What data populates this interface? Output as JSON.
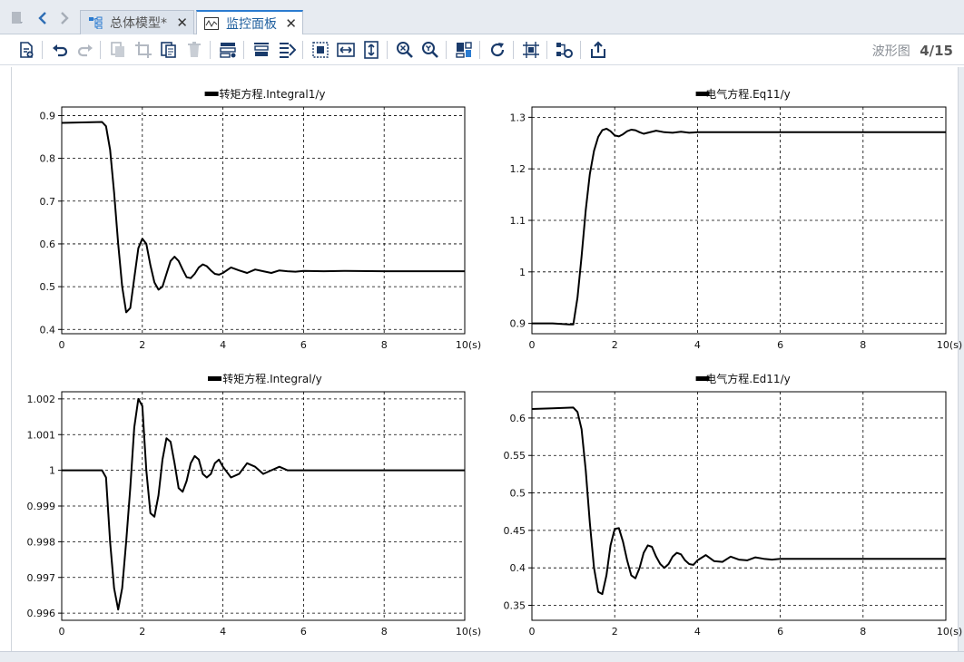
{
  "tabbar": {
    "tabs": [
      {
        "label": "总体模型*",
        "active": false
      },
      {
        "label": "监控面板",
        "active": true
      }
    ]
  },
  "toolbar": {
    "view_label": "波形图",
    "page_indicator": "4/15",
    "icons": [
      "new-page-icon",
      "undo-icon",
      "redo-icon",
      "copy-icon",
      "crop-icon",
      "paste-icon",
      "delete-icon",
      "layout-icon",
      "align-icon",
      "align-right-icon",
      "fit-selection-icon",
      "fit-width-icon",
      "fit-height-icon",
      "zoom-in-icon",
      "zoom-out-icon",
      "panel-icon",
      "refresh-icon",
      "grid-select-icon",
      "connect-icon",
      "export-icon"
    ]
  },
  "colors": {
    "accent": "#2b7bd0",
    "curve": "#000000",
    "grid": "#000000"
  },
  "chart_data": [
    {
      "type": "line",
      "title": "转矩方程.Integral1/y",
      "x_unit_label": "10(s)",
      "xlim": [
        0,
        10
      ],
      "ylim": [
        0.39,
        0.92
      ],
      "xticks": [
        0,
        2,
        4,
        6,
        8,
        10
      ],
      "yticks": [
        0.4,
        0.5,
        0.6,
        0.7,
        0.8,
        0.9
      ],
      "ytick_labels": [
        "0.4",
        "0.5",
        "0.6",
        "0.7",
        "0.8",
        "0.9"
      ],
      "grid": true,
      "legend": "top-center",
      "series": [
        {
          "name": "转矩方程.Integral1/y",
          "x": [
            0,
            0.5,
            1.0,
            1.1,
            1.2,
            1.3,
            1.4,
            1.5,
            1.6,
            1.7,
            1.8,
            1.9,
            2.0,
            2.1,
            2.2,
            2.3,
            2.4,
            2.5,
            2.6,
            2.7,
            2.8,
            2.9,
            3.0,
            3.1,
            3.2,
            3.3,
            3.4,
            3.5,
            3.6,
            3.7,
            3.8,
            3.9,
            4.0,
            4.2,
            4.4,
            4.6,
            4.8,
            5.0,
            5.2,
            5.4,
            5.6,
            5.8,
            6.0,
            6.5,
            7.0,
            8.0,
            9.0,
            10.0
          ],
          "y": [
            0.883,
            0.884,
            0.885,
            0.875,
            0.82,
            0.72,
            0.6,
            0.5,
            0.44,
            0.45,
            0.52,
            0.59,
            0.612,
            0.6,
            0.55,
            0.51,
            0.493,
            0.5,
            0.53,
            0.56,
            0.57,
            0.56,
            0.54,
            0.522,
            0.52,
            0.53,
            0.545,
            0.552,
            0.548,
            0.538,
            0.53,
            0.528,
            0.532,
            0.545,
            0.538,
            0.532,
            0.54,
            0.536,
            0.532,
            0.538,
            0.536,
            0.535,
            0.537,
            0.536,
            0.537,
            0.536,
            0.536,
            0.536
          ]
        }
      ]
    },
    {
      "type": "line",
      "title": "电气方程.Eq11/y",
      "x_unit_label": "10(s)",
      "xlim": [
        0,
        10
      ],
      "ylim": [
        0.88,
        1.32
      ],
      "xticks": [
        0,
        2,
        4,
        6,
        8,
        10
      ],
      "yticks": [
        0.9,
        1.0,
        1.1,
        1.2,
        1.3
      ],
      "ytick_labels": [
        "0.9",
        "1",
        "1.1",
        "1.2",
        "1.3"
      ],
      "grid": true,
      "legend": "top-center",
      "series": [
        {
          "name": "电气方程.Eq11/y",
          "x": [
            0,
            0.5,
            0.9,
            1.0,
            1.1,
            1.2,
            1.3,
            1.4,
            1.5,
            1.6,
            1.7,
            1.8,
            1.9,
            2.0,
            2.1,
            2.2,
            2.3,
            2.4,
            2.5,
            2.6,
            2.7,
            2.8,
            3.0,
            3.2,
            3.4,
            3.6,
            3.8,
            4.0,
            4.5,
            5.0,
            6.0,
            7.0,
            8.0,
            9.0,
            10.0
          ],
          "y": [
            0.9,
            0.9,
            0.898,
            0.898,
            0.95,
            1.03,
            1.12,
            1.19,
            1.235,
            1.262,
            1.275,
            1.278,
            1.273,
            1.265,
            1.263,
            1.267,
            1.273,
            1.276,
            1.275,
            1.271,
            1.268,
            1.27,
            1.274,
            1.271,
            1.27,
            1.272,
            1.27,
            1.271,
            1.271,
            1.271,
            1.271,
            1.271,
            1.271,
            1.271,
            1.271
          ]
        }
      ]
    },
    {
      "type": "line",
      "title": "转矩方程.Integral/y",
      "x_unit_label": "10(s)",
      "xlim": [
        0,
        10
      ],
      "ylim": [
        0.9958,
        1.0022
      ],
      "xticks": [
        0,
        2,
        4,
        6,
        8,
        10
      ],
      "yticks": [
        0.996,
        0.997,
        0.998,
        0.999,
        1.0,
        1.001,
        1.002
      ],
      "ytick_labels": [
        "0.996",
        "0.997",
        "0.998",
        "0.999",
        "1",
        "1.001",
        "1.002"
      ],
      "grid": true,
      "legend": "top-center",
      "series": [
        {
          "name": "转矩方程.Integral/y",
          "x": [
            0,
            0.5,
            1.0,
            1.1,
            1.2,
            1.3,
            1.4,
            1.5,
            1.6,
            1.7,
            1.8,
            1.9,
            2.0,
            2.1,
            2.2,
            2.3,
            2.4,
            2.5,
            2.6,
            2.7,
            2.8,
            2.9,
            3.0,
            3.1,
            3.2,
            3.3,
            3.4,
            3.5,
            3.6,
            3.7,
            3.8,
            3.9,
            4.0,
            4.2,
            4.4,
            4.6,
            4.8,
            5.0,
            5.2,
            5.4,
            5.6,
            5.8,
            6.0,
            6.5,
            7.0,
            8.0,
            9.0,
            10.0
          ],
          "y": [
            1.0,
            1.0,
            1.0,
            0.9998,
            0.998,
            0.9967,
            0.9961,
            0.9967,
            0.998,
            0.9995,
            1.0012,
            1.002,
            1.0018,
            1.0,
            0.9988,
            0.9987,
            0.9993,
            1.0003,
            1.0009,
            1.0008,
            1.0002,
            0.9995,
            0.9994,
            0.9997,
            1.0002,
            1.0004,
            1.0003,
            0.9999,
            0.9998,
            0.9999,
            1.0002,
            1.0003,
            1.0001,
            0.9998,
            0.9999,
            1.0002,
            1.0001,
            0.9999,
            1.0,
            1.0001,
            1.0,
            1.0,
            1.0,
            1.0,
            1.0,
            1.0,
            1.0,
            1.0
          ]
        }
      ]
    },
    {
      "type": "line",
      "title": "电气方程.Ed11/y",
      "x_unit_label": "10(s)",
      "xlim": [
        0,
        10
      ],
      "ylim": [
        0.33,
        0.635
      ],
      "xticks": [
        0,
        2,
        4,
        6,
        8,
        10
      ],
      "yticks": [
        0.35,
        0.4,
        0.45,
        0.5,
        0.55,
        0.6
      ],
      "ytick_labels": [
        "0.35",
        "0.4",
        "0.45",
        "0.5",
        "0.55",
        "0.6"
      ],
      "grid": true,
      "legend": "top-center",
      "series": [
        {
          "name": "电气方程.Ed11/y",
          "x": [
            0,
            0.5,
            1.0,
            1.1,
            1.2,
            1.3,
            1.4,
            1.5,
            1.6,
            1.7,
            1.8,
            1.9,
            2.0,
            2.1,
            2.2,
            2.3,
            2.4,
            2.5,
            2.6,
            2.7,
            2.8,
            2.9,
            3.0,
            3.1,
            3.2,
            3.3,
            3.4,
            3.5,
            3.6,
            3.7,
            3.8,
            3.9,
            4.0,
            4.2,
            4.4,
            4.6,
            4.8,
            5.0,
            5.2,
            5.4,
            5.6,
            5.8,
            6.0,
            6.5,
            7.0,
            8.0,
            9.0,
            10.0
          ],
          "y": [
            0.612,
            0.613,
            0.614,
            0.608,
            0.585,
            0.53,
            0.46,
            0.4,
            0.368,
            0.365,
            0.39,
            0.43,
            0.452,
            0.453,
            0.435,
            0.41,
            0.39,
            0.386,
            0.4,
            0.42,
            0.43,
            0.428,
            0.415,
            0.405,
            0.4,
            0.405,
            0.415,
            0.42,
            0.418,
            0.41,
            0.405,
            0.404,
            0.41,
            0.417,
            0.409,
            0.408,
            0.415,
            0.411,
            0.41,
            0.414,
            0.412,
            0.411,
            0.412,
            0.412,
            0.412,
            0.412,
            0.412,
            0.412
          ]
        }
      ]
    }
  ]
}
